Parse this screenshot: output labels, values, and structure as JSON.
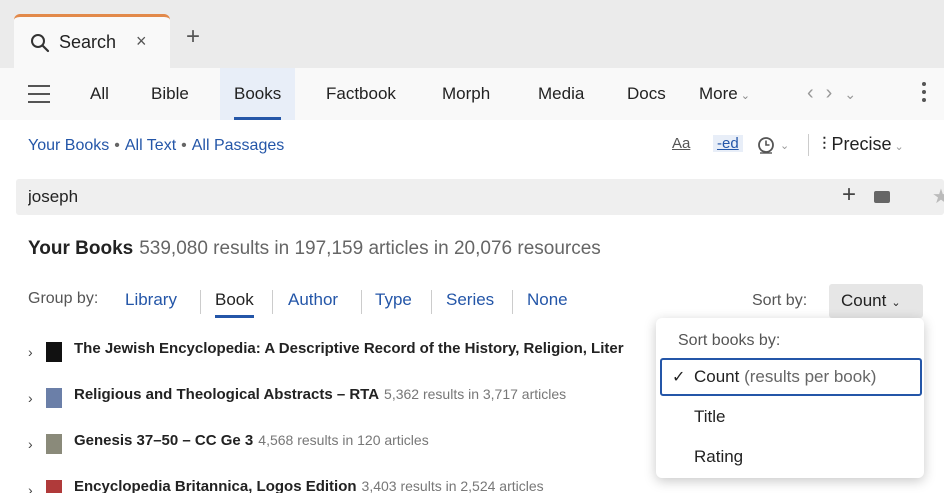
{
  "tab": {
    "label": "Search",
    "close": "×",
    "new": "+"
  },
  "nav": {
    "items": [
      "All",
      "Bible",
      "Books",
      "Factbook",
      "Morph",
      "Media",
      "Docs"
    ],
    "active": "Books",
    "more": "More",
    "back": "‹",
    "forward": "›",
    "history": "⌄"
  },
  "scope": {
    "books": "Your Books",
    "text": "All Text",
    "passages": "All Passages",
    "sep": "•"
  },
  "tools": {
    "case": "Aa",
    "ed": "-ed",
    "precise": "Precise"
  },
  "search": {
    "value": "joseph",
    "add": "+",
    "star": "★"
  },
  "summary": {
    "label": "Your Books",
    "count": "539,080 results in 197,159 articles in 20,076 resources"
  },
  "groupby": {
    "label": "Group by:",
    "options": [
      "Library",
      "Book",
      "Author",
      "Type",
      "Series",
      "None"
    ],
    "active": "Book"
  },
  "sortby": {
    "label": "Sort by:",
    "value": "Count"
  },
  "results": [
    {
      "title": "The Jewish Encyclopedia: A Descriptive Record of the History, Religion, Liter",
      "stats": "",
      "cover": "#111111"
    },
    {
      "title": "Religious and Theological Abstracts – RTA",
      "stats": "5,362 results in 3,717 articles",
      "cover": "#6b7fa8"
    },
    {
      "title": "Genesis 37–50 – CC Ge 3",
      "stats": "4,568 results in 120 articles",
      "cover": "#8a8a7a"
    },
    {
      "title": "Encyclopedia Britannica, Logos Edition",
      "stats": "3,403 results in 2,524 articles",
      "cover": "#b03a3a"
    }
  ],
  "sortmenu": {
    "header": "Sort books by:",
    "items": [
      {
        "label": "Count",
        "hint": "(results per book)",
        "selected": true
      },
      {
        "label": "Title",
        "hint": "",
        "selected": false
      },
      {
        "label": "Rating",
        "hint": "",
        "selected": false
      }
    ]
  },
  "colors": {
    "accent": "#2456a8",
    "tab_accent": "#e2894a"
  }
}
